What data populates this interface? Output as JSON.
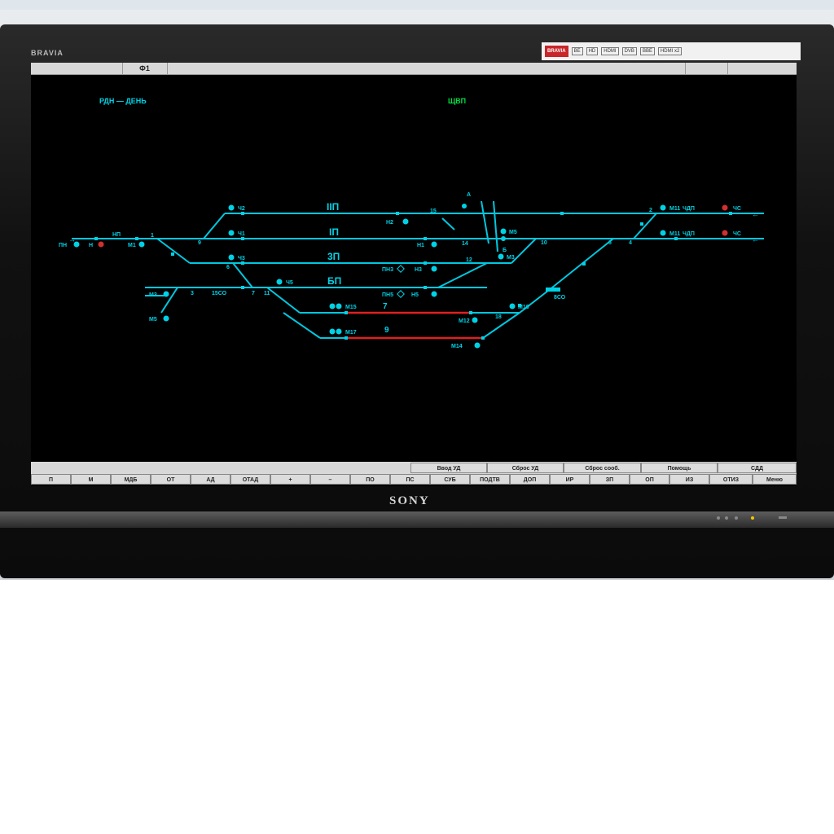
{
  "brand": {
    "model": "BRAVIA",
    "maker": "SONY",
    "badge": "BRAVIA",
    "badges": [
      "BE",
      "HD",
      "HDMI",
      "DVB",
      "BBE",
      "HDMI x2"
    ]
  },
  "tabs": [
    {
      "label": ""
    },
    {
      "label": "Ф1"
    },
    {
      "label": ""
    },
    {
      "label": ""
    },
    {
      "label": ""
    }
  ],
  "header": {
    "left": "РДН — ДЕНЬ",
    "center": "ЩВП"
  },
  "tracks": [
    {
      "label": "IIП"
    },
    {
      "label": "IП"
    },
    {
      "label": "3П"
    },
    {
      "label": "БП"
    },
    {
      "label": "7"
    },
    {
      "label": "9"
    }
  ],
  "signals": {
    "ch2": "Ч2",
    "ch1": "Ч1",
    "ch3": "Ч3",
    "ch5": "Ч5",
    "n2": "Н2",
    "n1": "Н1",
    "n3": "Н3",
    "n5": "Н5",
    "pn3": "ПН3",
    "pn5": "ПН5",
    "m15": "М15",
    "m17": "М17",
    "m12": "М12",
    "m14": "М14",
    "m10": "М10",
    "m5": "М5",
    "m3": "М3",
    "m11a": "М11",
    "m11b": "М11",
    "chdp_a": "ЧДП",
    "chdp_b": "ЧДП",
    "chs_a": "ЧС",
    "chs_b": "ЧС",
    "pn": "ПН",
    "n": "Н",
    "np": "НП",
    "m1": "М1",
    "m3l": "М3",
    "m5l": "М5",
    "a": "А",
    "b": "Б"
  },
  "switches": {
    "s1": "1",
    "s9": "9",
    "s6": "6",
    "s3": "3",
    "s15co": "15СО",
    "s7": "7",
    "s11": "11",
    "s15": "15",
    "s14": "14",
    "s12": "12",
    "s10": "10",
    "s6r": "6",
    "s4": "4",
    "s2": "2",
    "s18": "18",
    "s8co": "8СО"
  },
  "status_buttons": [
    "Ввод УД",
    "Сброс УД",
    "Сброс сооб.",
    "Помощь",
    "СДД"
  ],
  "command_buttons": [
    "П",
    "М",
    "МДБ",
    "ОТ",
    "АД",
    "ОТАД",
    "+",
    "–",
    "ПО",
    "ПС",
    "СУБ",
    "ПОДТВ",
    "ДОП",
    "ИР",
    "ЗП",
    "ОП",
    "ИЗ",
    "ОТИЗ",
    "Меню"
  ],
  "colors": {
    "track": "#00c8e0",
    "label_cyan": "#00d2e6",
    "label_green": "#00e040",
    "occupied": "#e02020",
    "signal_red": "#d03030"
  }
}
